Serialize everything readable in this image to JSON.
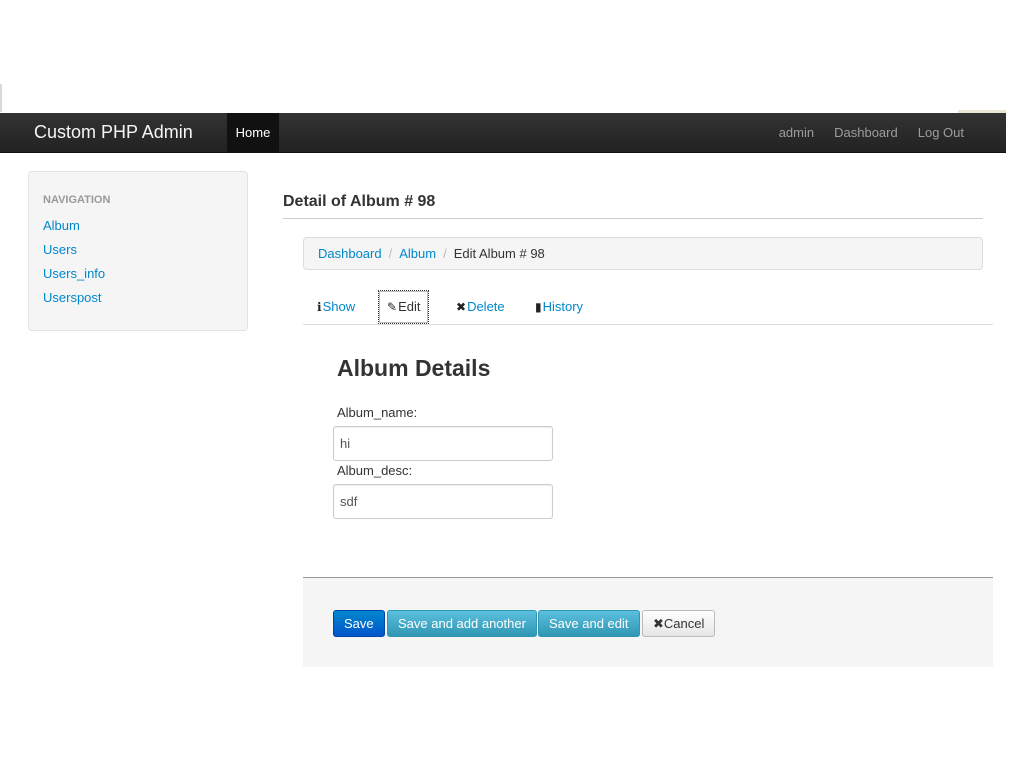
{
  "navbar": {
    "brand": "Custom PHP Admin",
    "home": "Home",
    "right_items": [
      "admin",
      "Dashboard",
      "Log Out"
    ]
  },
  "sidebar": {
    "header": "NAVIGATION",
    "items": [
      "Album",
      "Users",
      "Users_info",
      "Userspost"
    ]
  },
  "page": {
    "title": "Detail of Album # 98"
  },
  "breadcrumb": {
    "items": [
      "Dashboard",
      "Album"
    ],
    "active": "Edit Album # 98"
  },
  "tabs": [
    {
      "label": "Show",
      "icon": "info-icon",
      "glyph": "ℹ",
      "active": false
    },
    {
      "label": "Edit",
      "icon": "pencil-icon",
      "glyph": "✎",
      "active": true
    },
    {
      "label": "Delete",
      "icon": "close-icon",
      "glyph": "✖",
      "active": false
    },
    {
      "label": "History",
      "icon": "book-icon",
      "glyph": "▮",
      "active": false
    }
  ],
  "form": {
    "title": "Album Details",
    "fields": [
      {
        "label": "Album_name:",
        "value": "hi"
      },
      {
        "label": "Album_desc:",
        "value": "sdf"
      }
    ]
  },
  "actions": {
    "save": "Save",
    "save_add": "Save and add another",
    "save_edit": "Save and edit",
    "cancel": "Cancel",
    "cancel_glyph": "✖"
  },
  "colors": {
    "link": "#0088cc",
    "navbar": "#222222",
    "primary": "#0088cc",
    "info": "#5bc0de"
  }
}
